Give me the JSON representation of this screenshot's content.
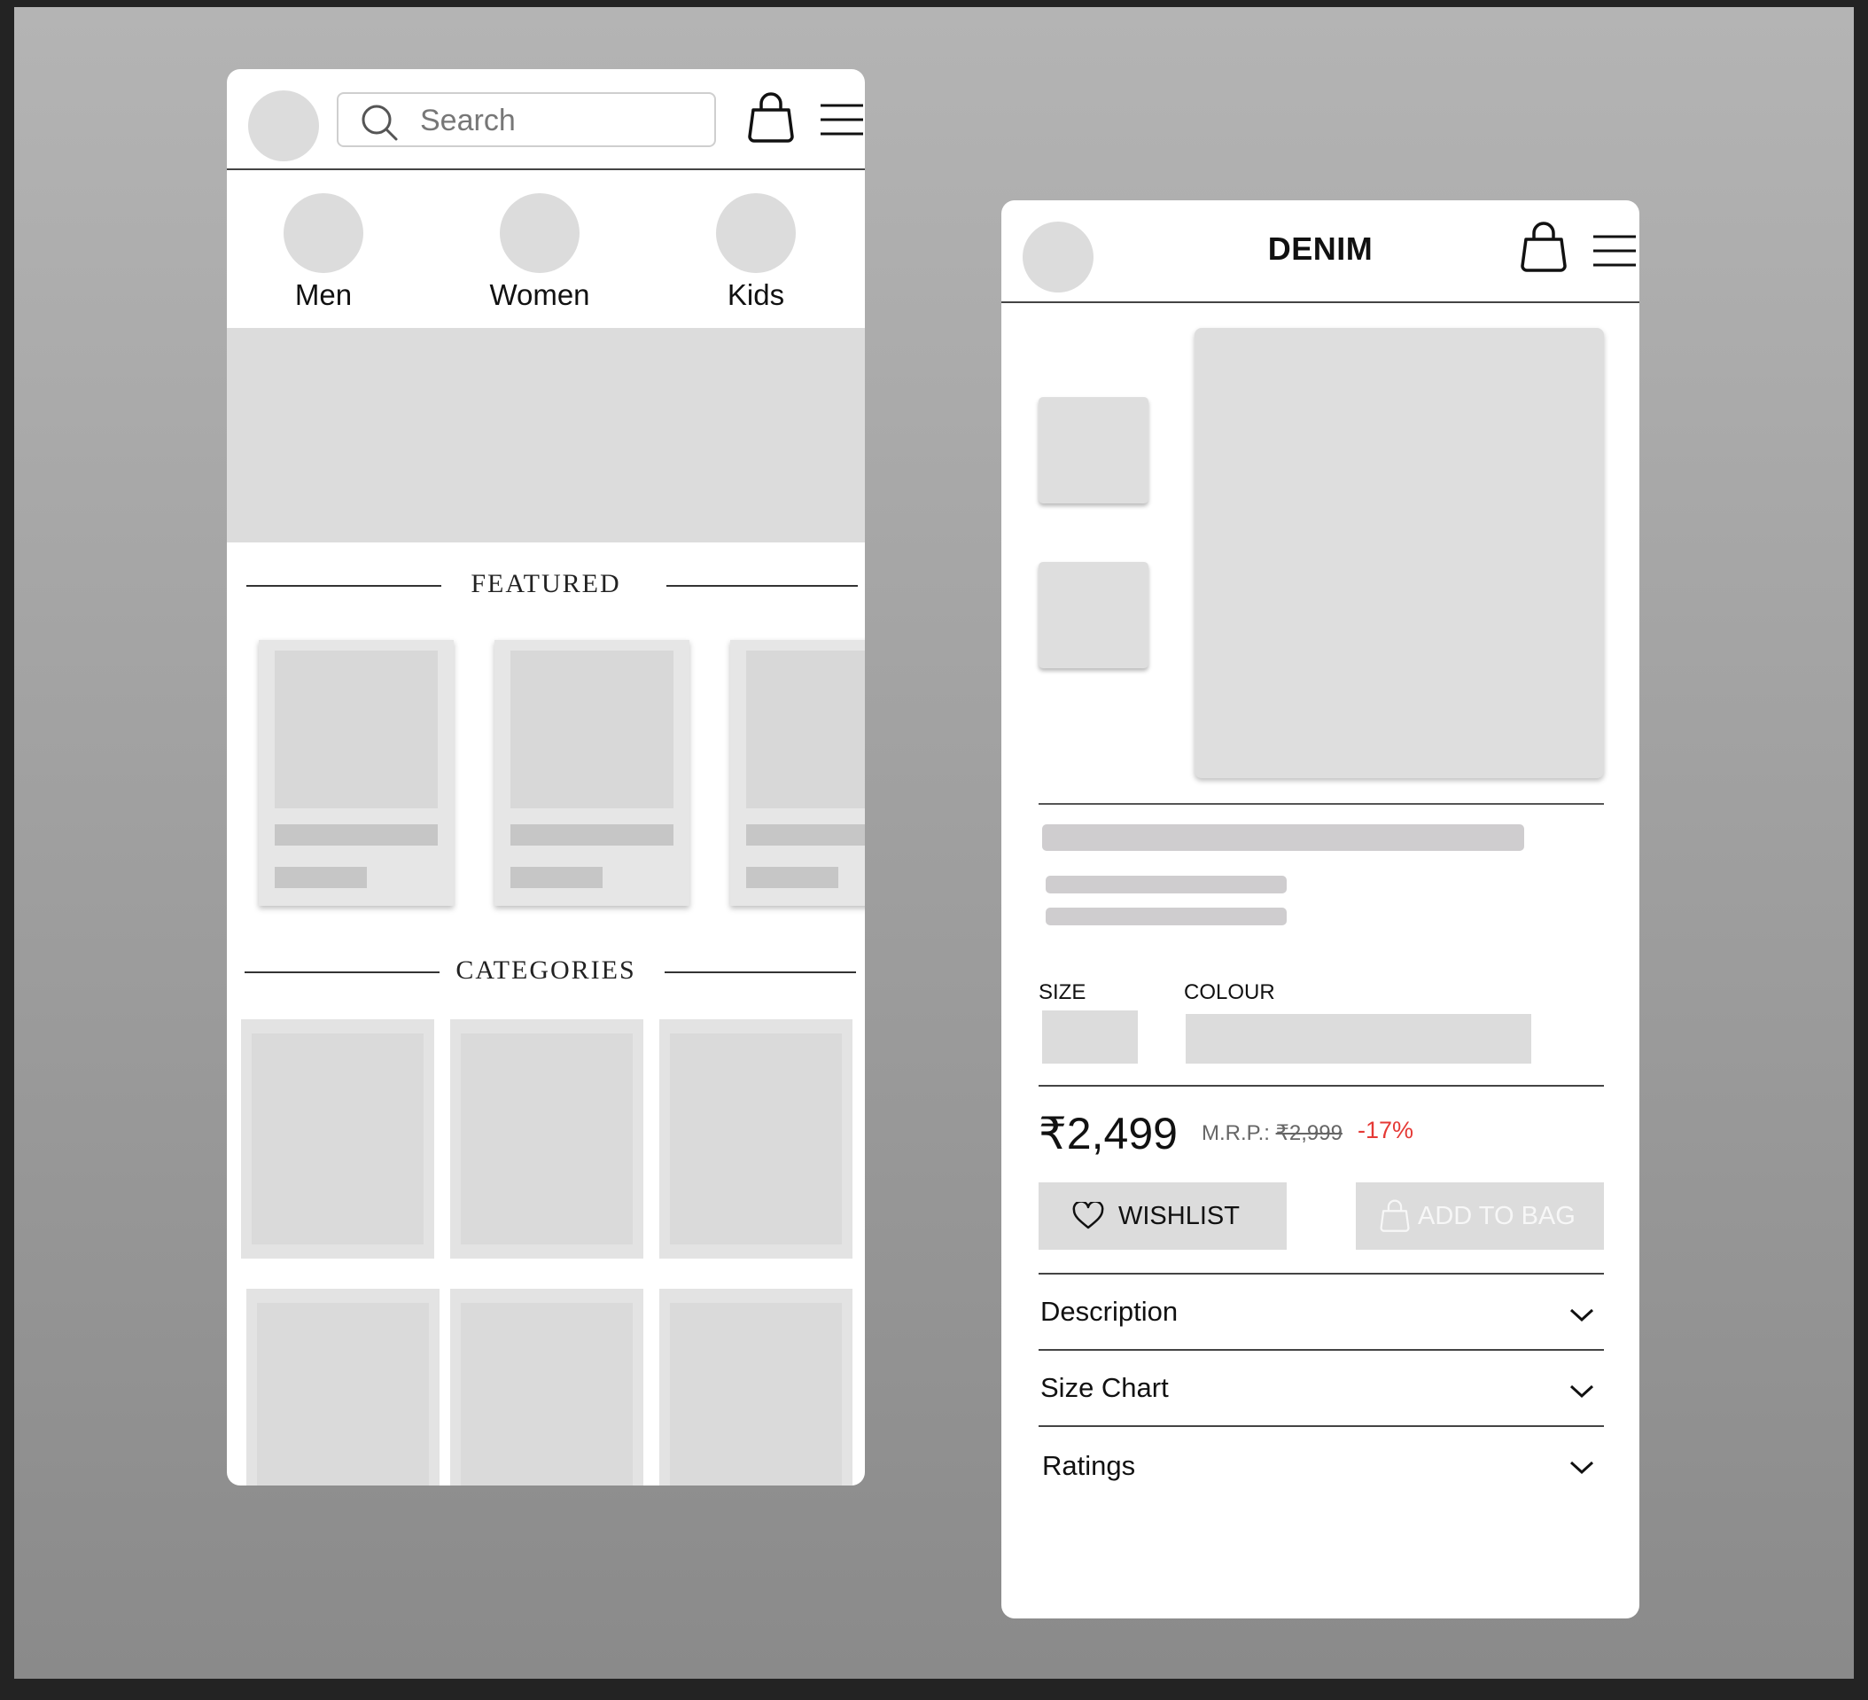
{
  "home": {
    "search_placeholder": "Search",
    "categories": [
      {
        "label": "Men"
      },
      {
        "label": "Women"
      },
      {
        "label": "Kids"
      }
    ],
    "featured_heading": "FEATURED",
    "categories_heading": "CATEGORIES"
  },
  "product": {
    "title": "DENIM",
    "size_label": "SIZE",
    "colour_label": "COLOUR",
    "price": "₹2,499",
    "mrp_label": "M.R.P.:",
    "mrp_value": "₹2,999",
    "discount": "-17%",
    "wishlist_label": "WISHLIST",
    "add_to_bag_label": "ADD TO BAG",
    "accordions": [
      {
        "label": "Description"
      },
      {
        "label": "Size Chart"
      },
      {
        "label": "Ratings"
      }
    ],
    "colors": {
      "discount": "#e53935"
    }
  }
}
